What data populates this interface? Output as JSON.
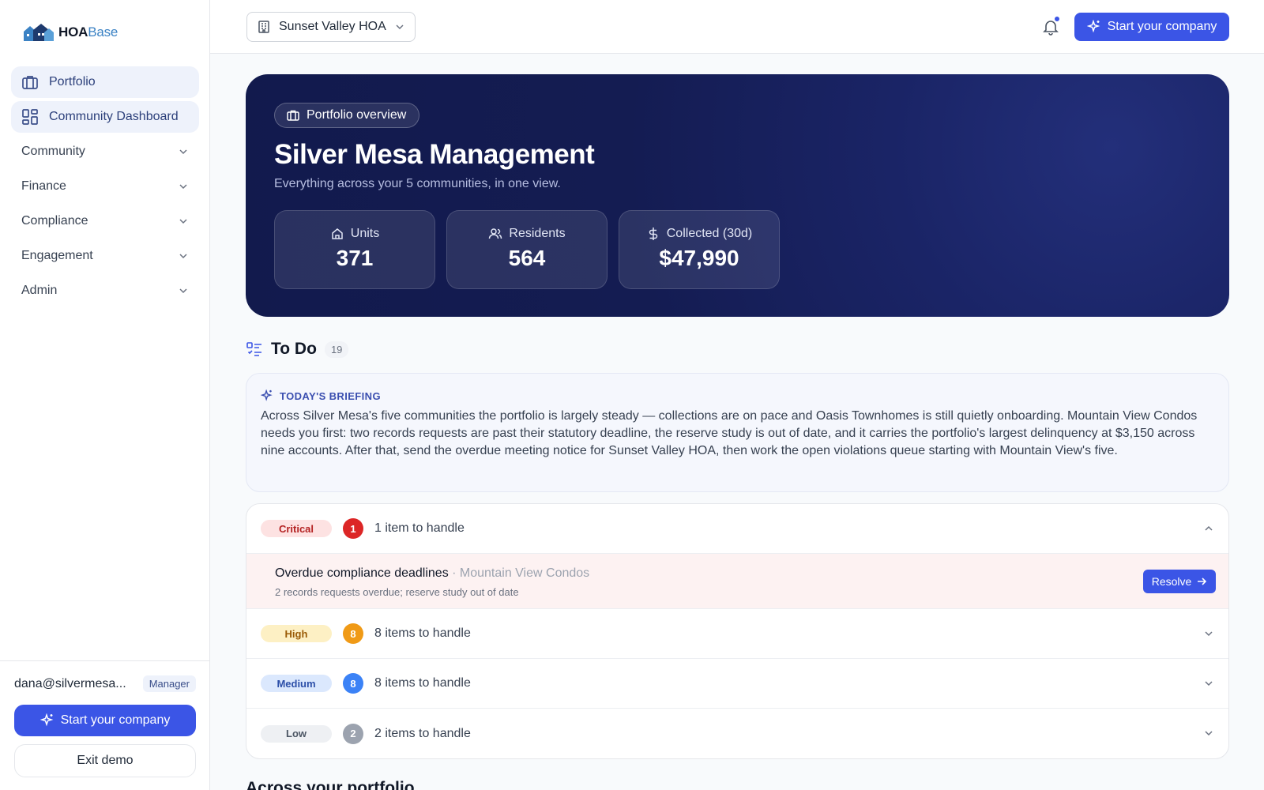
{
  "brand": {
    "name_main": "HOA",
    "name_accent": "Base"
  },
  "sidebar": {
    "items": [
      {
        "label": "Portfolio",
        "icon": "briefcase-icon",
        "active": true
      },
      {
        "label": "Community Dashboard",
        "icon": "dashboard-grid-icon",
        "active": true
      }
    ],
    "groups": [
      {
        "label": "Community"
      },
      {
        "label": "Finance"
      },
      {
        "label": "Compliance"
      },
      {
        "label": "Engagement"
      },
      {
        "label": "Admin"
      }
    ],
    "user": {
      "email": "dana@silvermesa...",
      "role": "Manager"
    },
    "start_label": "Start your company",
    "exit_label": "Exit demo"
  },
  "topbar": {
    "community": "Sunset Valley HOA",
    "start_label": "Start your company",
    "notification_dot": true
  },
  "hero": {
    "pill": "Portfolio overview",
    "title": "Silver Mesa Management",
    "subtitle": "Everything across your 5 communities, in one view.",
    "stats": [
      {
        "label": "Units",
        "value": "371",
        "icon": "home-icon"
      },
      {
        "label": "Residents",
        "value": "564",
        "icon": "users-icon"
      },
      {
        "label": "Collected (30d)",
        "value": "$47,990",
        "icon": "dollar-icon"
      }
    ]
  },
  "todo": {
    "title": "To Do",
    "count": "19",
    "briefing": {
      "tag": "TODAY'S BRIEFING",
      "text": "Across Silver Mesa's five communities the portfolio is largely steady — collections are on pace and Oasis Townhomes is still quietly onboarding. Mountain View Condos needs you first: two records requests are past their statutory deadline, the reserve study is out of date, and it carries the portfolio's largest delinquency at $3,150 across nine accounts. After that, send the overdue meeting notice for Sunset Valley HOA, then work the open violations queue starting with Mountain View's five."
    },
    "priorities": [
      {
        "level": "Critical",
        "count": "1",
        "text": "1 item to handle",
        "expanded": true,
        "badge_bg": "#fde2e2",
        "badge_fg": "#b42323",
        "num_bg": "#dc2626"
      },
      {
        "level": "High",
        "count": "8",
        "text": "8 items to handle",
        "expanded": false,
        "badge_bg": "#fdf0c4",
        "badge_fg": "#9a5b06",
        "num_bg": "#f09a16"
      },
      {
        "level": "Medium",
        "count": "8",
        "text": "8 items to handle",
        "expanded": false,
        "badge_bg": "#dbe8fd",
        "badge_fg": "#2c4fa8",
        "num_bg": "#3b82f6"
      },
      {
        "level": "Low",
        "count": "2",
        "text": "2 items to handle",
        "expanded": false,
        "badge_bg": "#eef0f3",
        "badge_fg": "#4b5563",
        "num_bg": "#9ca3af"
      }
    ],
    "critical_item": {
      "title": "Overdue compliance deadlines",
      "separator": " · ",
      "community": "Mountain View Condos",
      "detail": "2 records requests overdue; reserve study out of date",
      "action": "Resolve"
    }
  },
  "next_section_title": "Across your portfolio",
  "colors": {
    "accent": "#3b55e6",
    "hero_bg": "#141c52",
    "active_nav": "#eef2fb"
  }
}
